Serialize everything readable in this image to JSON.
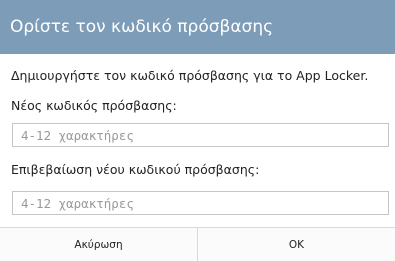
{
  "dialog": {
    "title": "Ορίστε τον κωδικό πρόσβασης",
    "description": "Δημιουργήστε τον κωδικό πρόσβασης για το App Locker.",
    "new_password_label": "Νέος κωδικός πρόσβασης:",
    "new_password_placeholder": "4-12 χαρακτήρες",
    "new_password_value": "",
    "confirm_password_label": "Επιβεβαίωση νέου κωδικού πρόσβασης:",
    "confirm_password_placeholder": "4-12 χαρακτήρες",
    "confirm_password_value": "",
    "cancel_label": "Ακύρωση",
    "ok_label": "OK"
  },
  "colors": {
    "header_background": "#7d9cb8",
    "header_text": "#ffffff",
    "field_border": "#c6c6c6",
    "divider": "#d9d9d9"
  }
}
